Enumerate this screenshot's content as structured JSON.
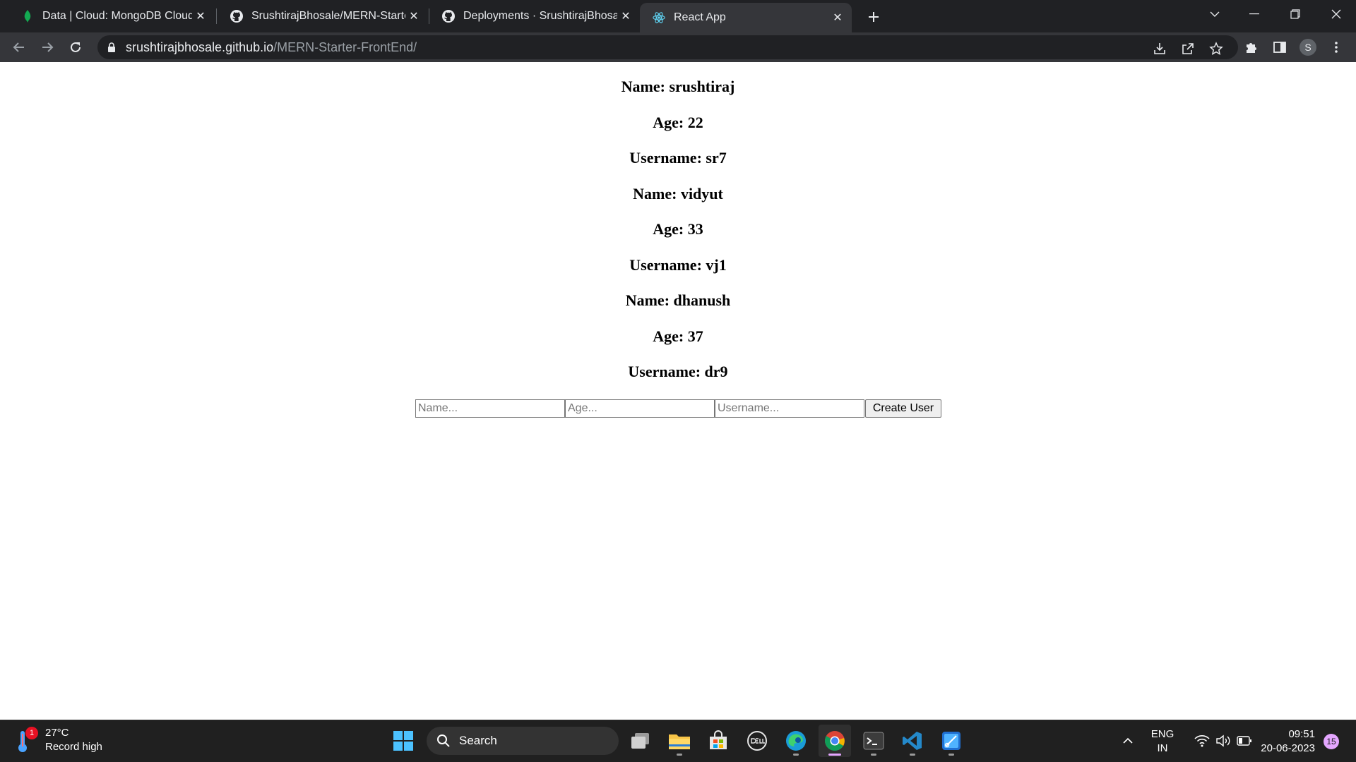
{
  "browser": {
    "tabs": [
      {
        "title": "Data | Cloud: MongoDB Cloud",
        "favicon": "mongodb-leaf-icon",
        "active": false
      },
      {
        "title": "SrushtirajBhosale/MERN-Starter-F",
        "favicon": "github-icon",
        "active": false
      },
      {
        "title": "Deployments · SrushtirajBhosale/",
        "favicon": "github-icon",
        "active": false
      },
      {
        "title": "React App",
        "favicon": "react-icon",
        "active": true
      }
    ],
    "url_host": "srushtirajbhosale.github.io",
    "url_path": "/MERN-Starter-FrontEnd/",
    "profile_initial": "S"
  },
  "page": {
    "users": [
      {
        "name": "Name: srushtiraj",
        "age": "Age: 22",
        "username": "Username: sr7"
      },
      {
        "name": "Name: vidyut",
        "age": "Age: 33",
        "username": "Username: vj1"
      },
      {
        "name": "Name: dhanush",
        "age": "Age: 37",
        "username": "Username: dr9"
      }
    ],
    "form": {
      "name_placeholder": "Name...",
      "age_placeholder": "Age...",
      "username_placeholder": "Username...",
      "submit_label": "Create User"
    }
  },
  "taskbar": {
    "weather": {
      "temp": "27°C",
      "desc": "Record high",
      "badge": "1"
    },
    "search_label": "Search",
    "language": {
      "line1": "ENG",
      "line2": "IN"
    },
    "time": "09:51",
    "date": "20-06-2023",
    "notification_count": "15"
  },
  "colors": {
    "titlebar": "#202124",
    "toolbar": "#35363a",
    "taskbar": "#202020",
    "react": "#61dafb",
    "vscode": "#2489ca",
    "chrome_active_indicator": "#e4a6ff"
  }
}
